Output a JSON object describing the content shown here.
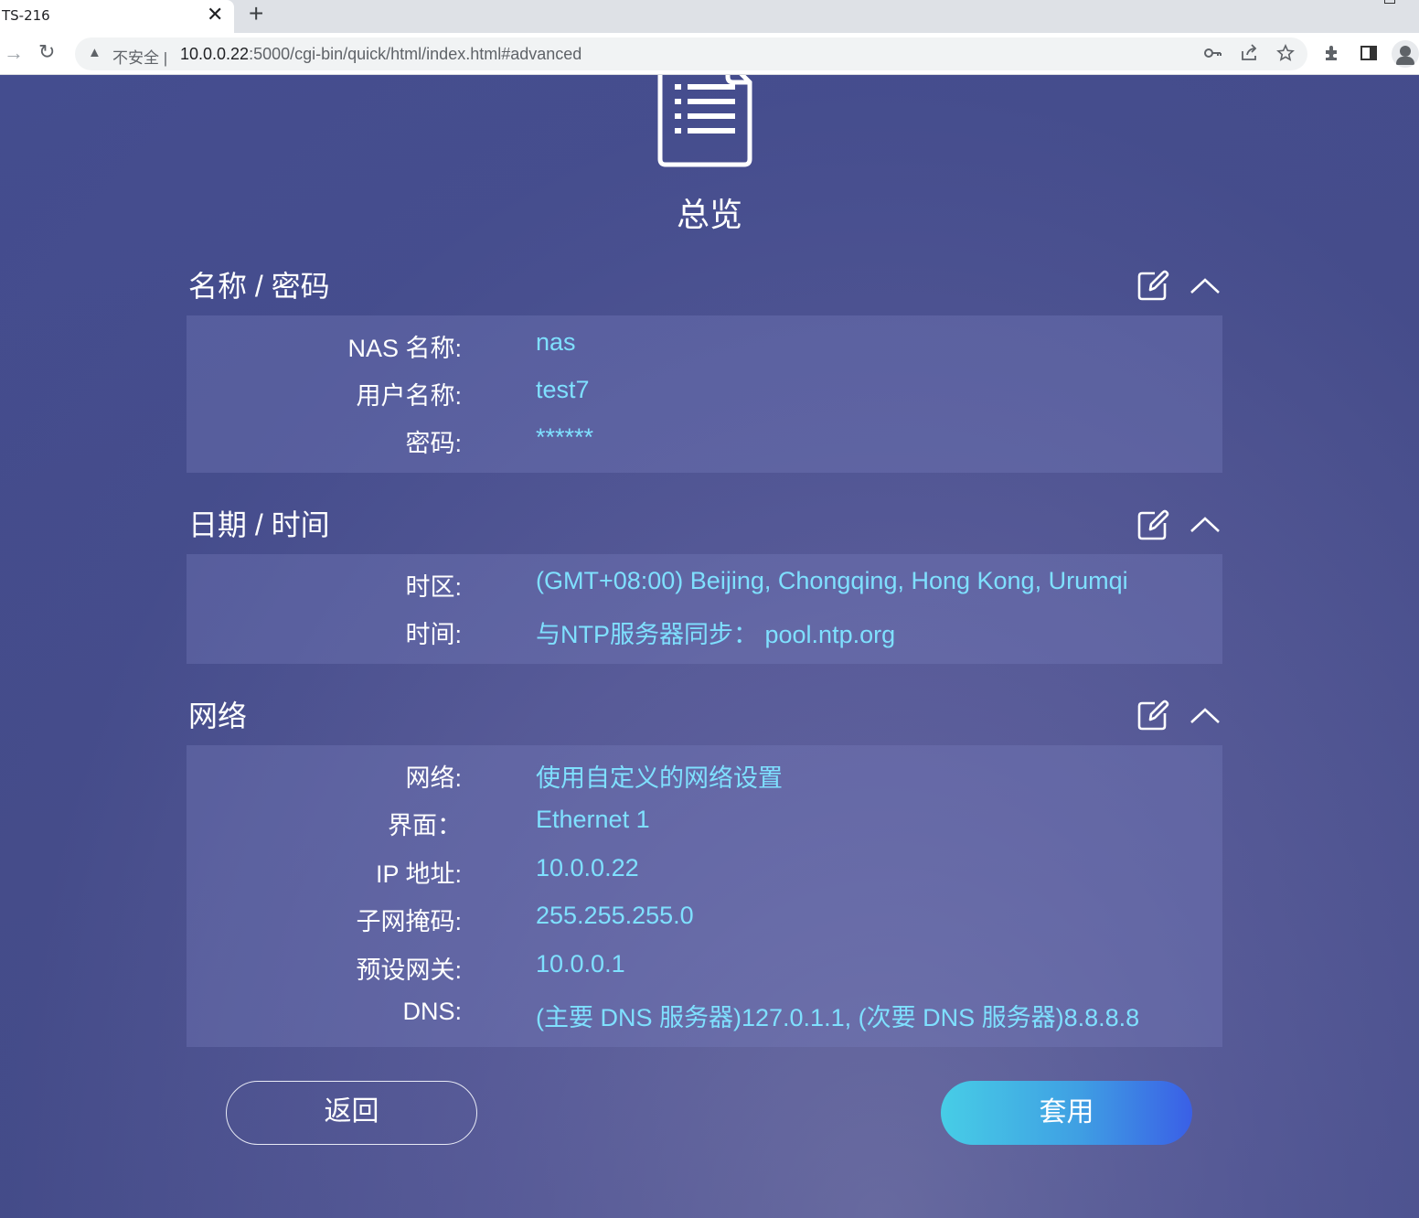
{
  "browser": {
    "tab_title": "TS-216",
    "tab_close": "✕",
    "new_tab": "+",
    "insecure_label": "不安全 |",
    "url_host": "10.0.0.22",
    "url_rest": ":5000/cgi-bin/quick/html/index.html#advanced"
  },
  "page": {
    "title": "总览"
  },
  "sections": {
    "name_password": {
      "title": "名称 / 密码",
      "rows": [
        {
          "label": "NAS 名称:",
          "value": "nas"
        },
        {
          "label": "用户名称:",
          "value": "test7"
        },
        {
          "label": "密码:",
          "value": "******"
        }
      ]
    },
    "date_time": {
      "title": "日期 / 时间",
      "rows": [
        {
          "label": "时区:",
          "value": "(GMT+08:00) Beijing, Chongqing, Hong Kong, Urumqi"
        },
        {
          "label": "时间:",
          "value": "与NTP服务器同步： pool.ntp.org"
        }
      ]
    },
    "network": {
      "title": "网络",
      "rows": [
        {
          "label": "网络:",
          "value": "使用自定义的网络设置"
        },
        {
          "label": "界面：",
          "value": "Ethernet 1"
        },
        {
          "label": "IP 地址:",
          "value": "10.0.0.22"
        },
        {
          "label": "子网掩码:",
          "value": "255.255.255.0"
        },
        {
          "label": "预设网关:",
          "value": "10.0.0.1"
        },
        {
          "label": "DNS:",
          "value": "(主要 DNS 服务器)127.0.1.1, (次要 DNS 服务器)8.8.8.8"
        }
      ]
    }
  },
  "buttons": {
    "back": "返回",
    "apply": "套用"
  },
  "colors": {
    "value_text": "#7fe0ff",
    "apply_gradient_start": "#47cde6",
    "apply_gradient_end": "#3a5fe6",
    "background": "#454c8a"
  }
}
